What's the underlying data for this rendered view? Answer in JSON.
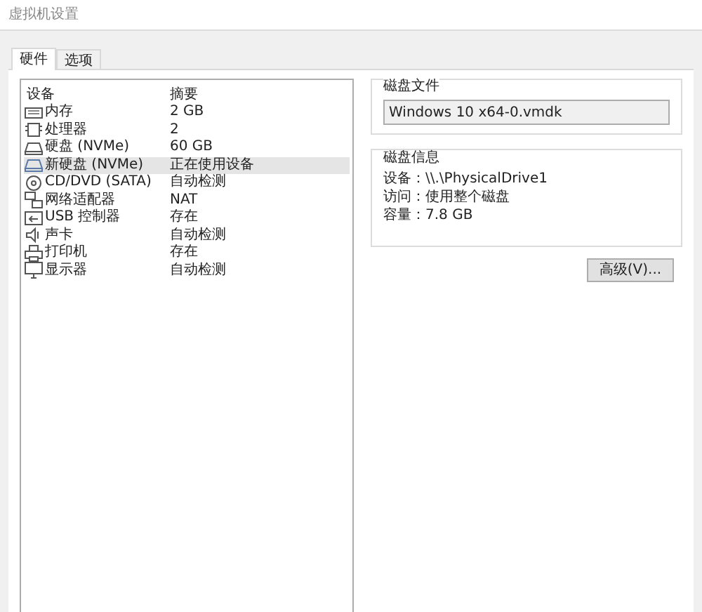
{
  "window": {
    "title": "虚拟机设置"
  },
  "tabs": [
    {
      "label": "硬件",
      "selected": true
    },
    {
      "label": "选项",
      "selected": false
    }
  ],
  "device_list": {
    "columns": [
      "设备",
      "摘要"
    ],
    "rows": [
      {
        "device": "内存",
        "summary": "2 GB",
        "selected": false
      },
      {
        "device": "处理器",
        "summary": "2",
        "selected": false
      },
      {
        "device": "硬盘 (NVMe)",
        "summary": "60 GB",
        "selected": false
      },
      {
        "device": "新硬盘 (NVMe)",
        "summary": "正在使用设备",
        "selected": true
      },
      {
        "device": "CD/DVD (SATA)",
        "summary": "自动检测",
        "selected": false
      },
      {
        "device": "网络适配器",
        "summary": "NAT",
        "selected": false
      },
      {
        "device": "USB 控制器",
        "summary": "存在",
        "selected": false
      },
      {
        "device": "声卡",
        "summary": "自动检测",
        "selected": false
      },
      {
        "device": "打印机",
        "summary": "存在",
        "selected": false
      },
      {
        "device": "显示器",
        "summary": "自动检测",
        "selected": false
      }
    ]
  },
  "disk_file": {
    "title": "磁盘文件",
    "value": "Windows 10 x64-0.vmdk"
  },
  "disk_info": {
    "title": "磁盘信息",
    "lines": [
      "设备：\\\\.\\PhysicalDrive1",
      "访问：使用整个磁盘",
      "容量：7.8 GB"
    ]
  },
  "advanced_button": "高级(V)..."
}
